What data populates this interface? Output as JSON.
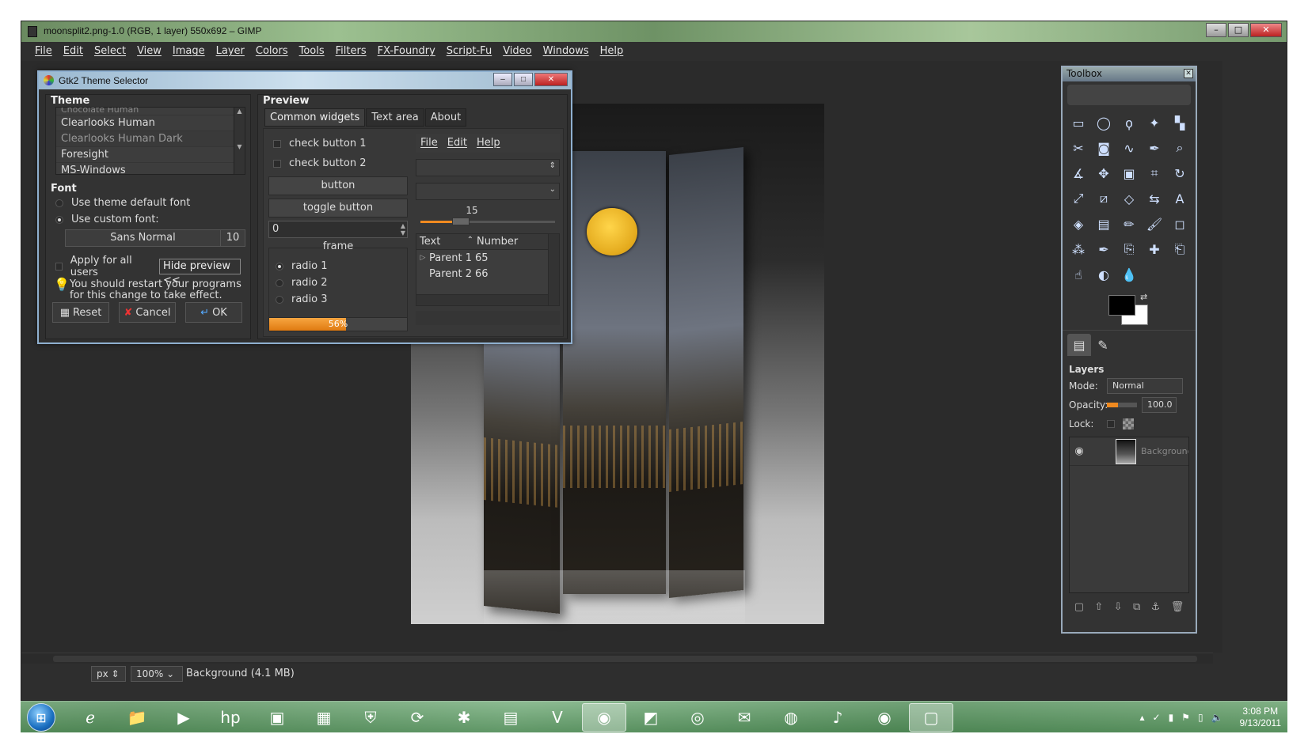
{
  "window": {
    "title": "moonsplit2.png-1.0 (RGB, 1 layer) 550x692 – GIMP",
    "min": "–",
    "max": "□",
    "close": "✕"
  },
  "menu": [
    "File",
    "Edit",
    "Select",
    "View",
    "Image",
    "Layer",
    "Colors",
    "Tools",
    "Filters",
    "FX-Foundry",
    "Script-Fu",
    "Video",
    "Windows",
    "Help"
  ],
  "status": {
    "unit": "px",
    "zoom": "100%",
    "layer_info": "Background (4.1 MB)"
  },
  "toolbox": {
    "title": "Toolbox",
    "tools": [
      "rect-select",
      "ellipse-select",
      "free-select",
      "fuzzy-select",
      "color-select",
      "scissors",
      "foreground-select",
      "paths",
      "color-picker",
      "zoom",
      "measure",
      "move",
      "align",
      "crop",
      "rotate",
      "scale",
      "shear",
      "perspective",
      "flip",
      "text",
      "bucket-fill",
      "blend",
      "pencil",
      "paintbrush",
      "eraser",
      "airbrush",
      "ink",
      "clone",
      "heal",
      "perspective-clone",
      "smudge",
      "dodge-burn",
      "blur"
    ],
    "layers_title": "Layers",
    "mode_label": "Mode:",
    "mode_value": "Normal",
    "opacity_label": "Opacity:",
    "opacity_value": "100.0",
    "lock_label": "Lock:",
    "layer_name": "Background"
  },
  "dialog": {
    "title": "Gtk2 Theme Selector",
    "theme_header": "Theme",
    "themes": [
      "Chocolate Human",
      "Clearlooks Human",
      "Clearlooks Human Dark",
      "Foresight",
      "MS-Windows"
    ],
    "selected_theme": "Clearlooks Human Dark",
    "font_header": "Font",
    "font_default": "Use theme default font",
    "font_custom": "Use custom font:",
    "font_name": "Sans Normal",
    "font_size": "10",
    "apply_all": "Apply for all users",
    "hide_preview": "Hide preview <<",
    "restart_hint_1": "You should restart your programs",
    "restart_hint_2": "for this change to take effect.",
    "reset": "Reset",
    "cancel": "Cancel",
    "ok": "OK",
    "preview_header": "Preview",
    "tabs": [
      "Common widgets",
      "Text area",
      "About"
    ],
    "check1": "check button 1",
    "check2": "check button 2",
    "button": "button",
    "toggle": "toggle button",
    "spin_value": "0",
    "frame_label": "frame",
    "radios": [
      "radio 1",
      "radio 2",
      "radio 3"
    ],
    "progress": 0.56,
    "progress_text": "56%",
    "mini_menu": [
      "File",
      "Edit",
      "Help"
    ],
    "scale_value": "15",
    "scale_fraction": 0.26,
    "tree_cols": [
      "Text",
      "Number"
    ],
    "tree_rows": [
      {
        "text": "Parent 1",
        "num": "65"
      },
      {
        "text": "Parent 2",
        "num": "66"
      }
    ]
  },
  "taskbar": {
    "icons": [
      "ie-icon",
      "folder-icon",
      "media-player-icon",
      "hp-icon",
      "app-icon",
      "app2-icon",
      "shield-app-icon",
      "app3-icon",
      "paint-splat-icon",
      "control-panel-icon",
      "v-app-icon",
      "gimp-icon",
      "app4-icon",
      "firefox-icon",
      "thunderbird-icon",
      "earth-icon",
      "media-icon",
      "gimp2-icon",
      "package-icon"
    ],
    "time": "3:08 PM",
    "date": "9/13/2011"
  }
}
